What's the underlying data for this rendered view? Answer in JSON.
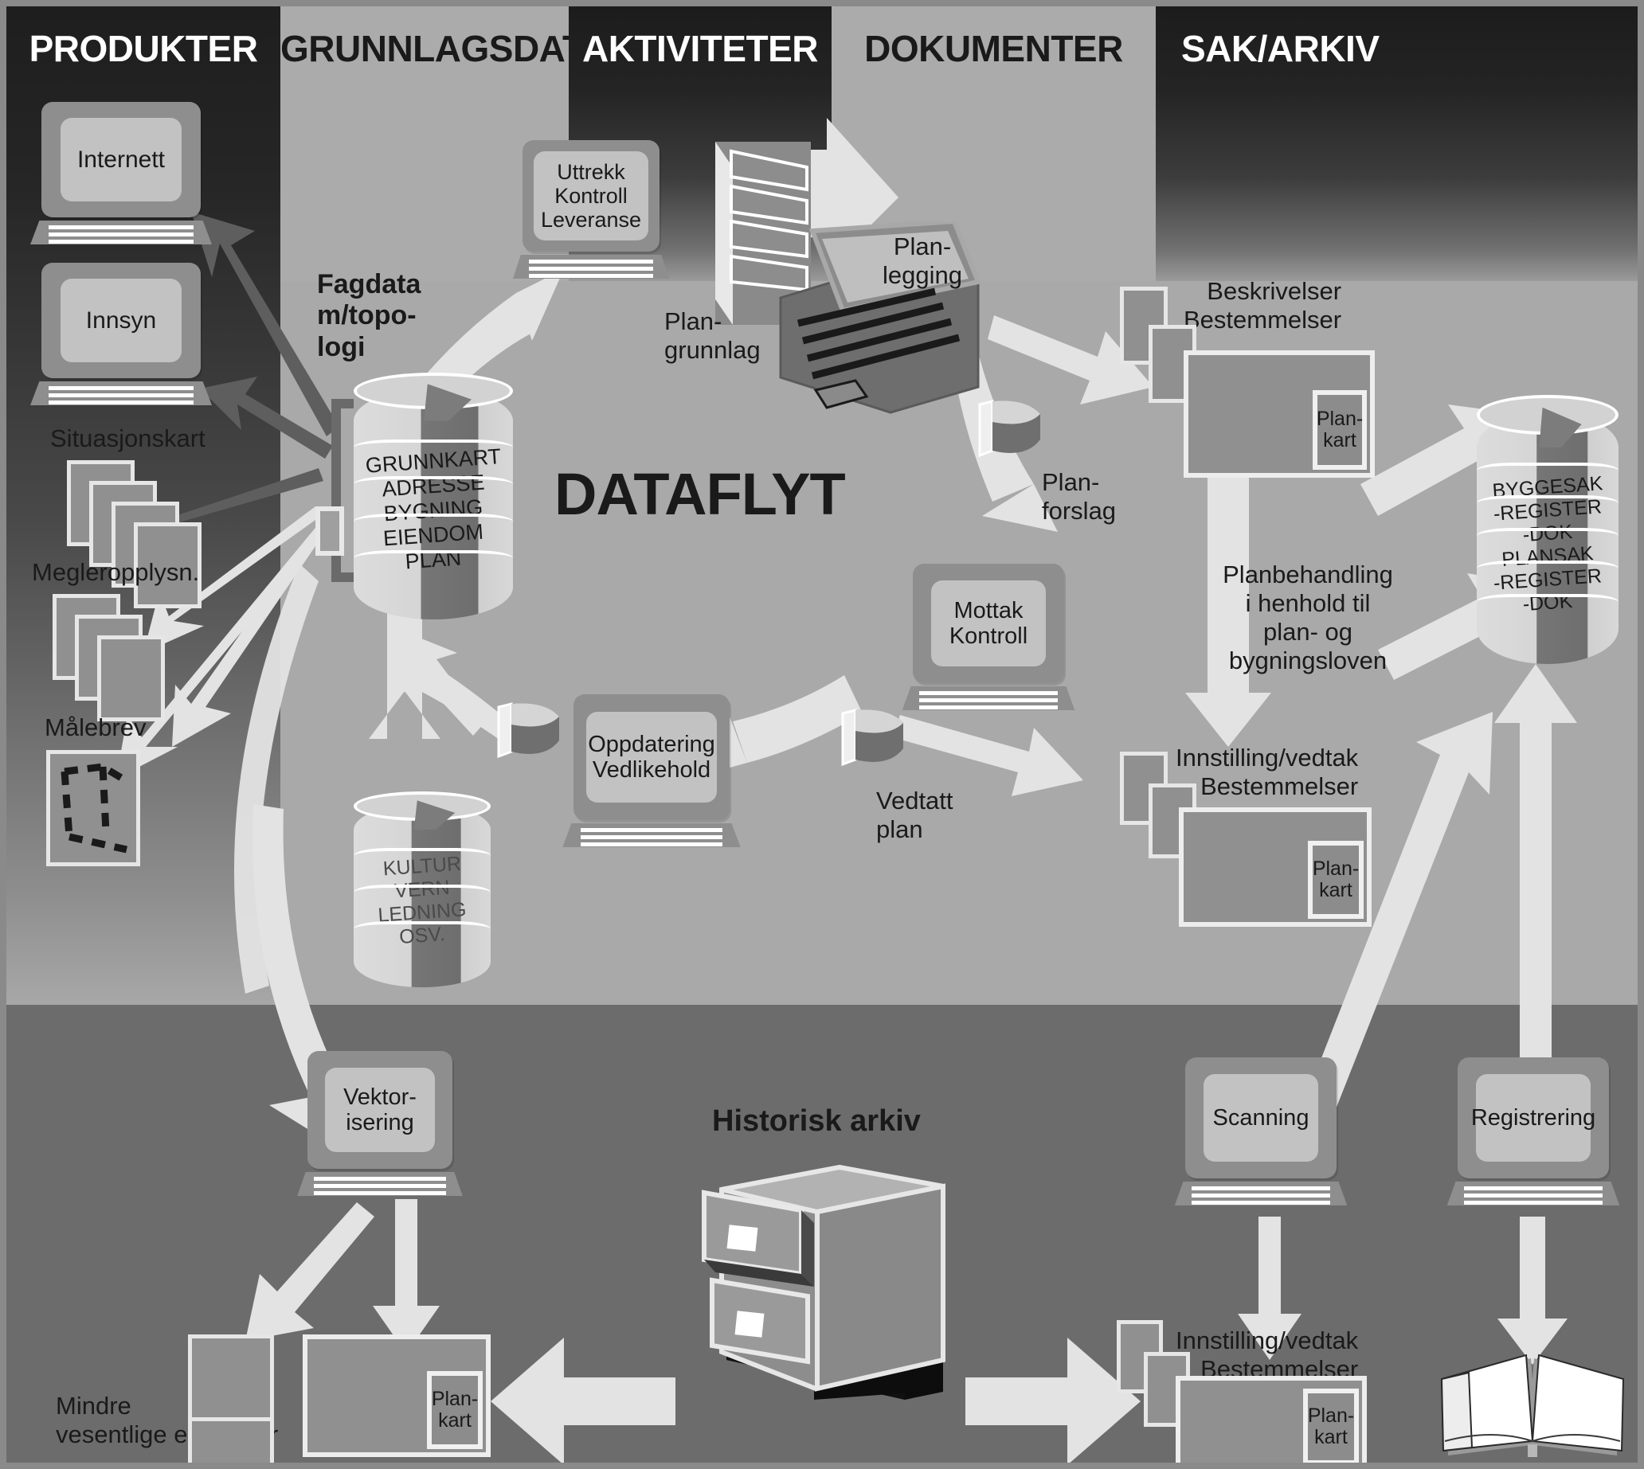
{
  "diagram": {
    "title": "DATAFLYT",
    "lower_section_title": "Historisk arkiv"
  },
  "columns": [
    {
      "label": "PRODUKTER",
      "style": "dark"
    },
    {
      "label": "GRUNNLAGSDATA",
      "style": "light"
    },
    {
      "label": "AKTIVITETER",
      "style": "dark"
    },
    {
      "label": "DOKUMENTER",
      "style": "light"
    },
    {
      "label": "SAK/ARKIV",
      "style": "dark"
    }
  ],
  "produkter": {
    "internett": "Internett",
    "innsyn": "Innsyn",
    "situasjonskart": "Situasjonskart",
    "megleropplysn": "Megleropplysn.",
    "malebrev": "Målebrev"
  },
  "grunnlagsdata": {
    "fagdata_label": "Fagdata\nm/topo-\nlogi",
    "fagdata_line1": "Fagdata",
    "fagdata_line2": "m/topo-",
    "fagdata_line3": "logi",
    "db_main_rows": [
      "GRUNNKART",
      "ADRESSE",
      "BYGNING",
      "EIENDOM",
      "PLAN"
    ],
    "db_second_rows": [
      "KULTUR",
      "VERN",
      "LEDNING",
      "OSV."
    ]
  },
  "aktiviteter": {
    "uttrekk": "Uttrekk\nKontroll\nLeveranse",
    "uttrekk_l1": "Uttrekk",
    "uttrekk_l2": "Kontroll",
    "uttrekk_l3": "Leveranse",
    "plangrunnlag_l1": "Plan-",
    "plangrunnlag_l2": "grunnlag",
    "planlegging_l1": "Plan-",
    "planlegging_l2": "legging",
    "mottak_l1": "Mottak",
    "mottak_l2": "Kontroll",
    "oppdatering_l1": "Oppdatering",
    "oppdatering_l2": "Vedlikehold",
    "vedtatt_l1": "Vedtatt",
    "vedtatt_l2": "plan",
    "planforslag_l1": "Plan-",
    "planforslag_l2": "forslag"
  },
  "dokumenter": {
    "beskrivelser_l1": "Beskrivelser",
    "beskrivelser_l2": "Bestemmelser",
    "plankart_l1": "Plan-",
    "plankart_l2": "kart",
    "planbehandling_l1": "Planbehandling",
    "planbehandling_l2": "i henhold til",
    "planbehandling_l3": "plan- og",
    "planbehandling_l4": "bygningsloven",
    "innstilling_l1": "Innstilling/vedtak",
    "innstilling_l2": "Bestemmelser",
    "plankart2_l1": "Plan-",
    "plankart2_l2": "kart"
  },
  "sakarkiv": {
    "db_rows": [
      "BYGGESAK",
      "-REGISTER",
      "-DOK",
      "PLANSAK",
      "-REGISTER",
      "-DOK"
    ]
  },
  "historisk": {
    "vektorisering_l1": "Vektor-",
    "vektorisering_l2": "isering",
    "mindre_l1": "Mindre",
    "mindre_l2": "vesentlige endringer",
    "plankart_l1": "Plan-",
    "plankart_l2": "kart",
    "scanning": "Scanning",
    "registrering": "Registrering",
    "innstilling_l1": "Innstilling/vedtak",
    "innstilling_l2": "Bestemmelser",
    "plankart2_l1": "Plan-",
    "plankart2_l2": "kart"
  },
  "colors": {
    "background": "#a9a9a9",
    "lower_background": "#6c6c6c",
    "band_dark": "#1e1e1e",
    "band_light": "#ababab",
    "arrow_light": "#e2e2e2",
    "arrow_dark": "#5e5e5e",
    "monitor_case": "#8e8e8e",
    "monitor_screen": "#c2c2c2",
    "text": "#1a1a1a",
    "white": "#ffffff"
  }
}
